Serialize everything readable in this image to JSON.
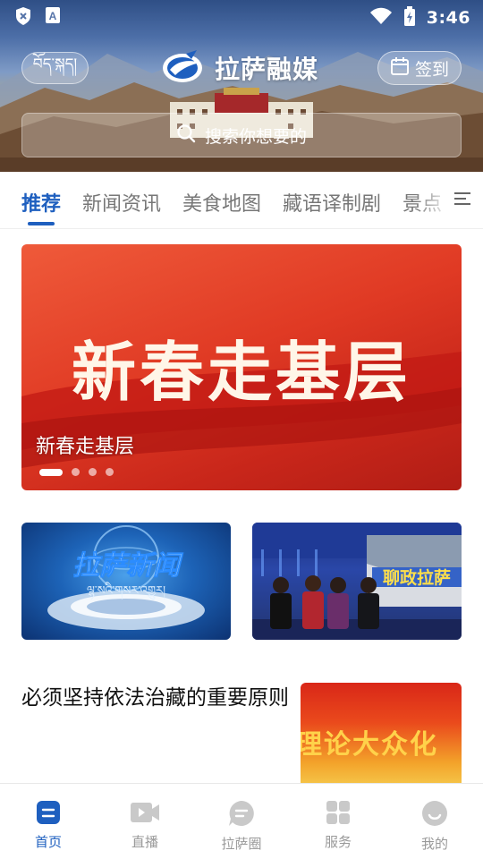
{
  "status_bar": {
    "time": "3:46",
    "icons": [
      "shield-x-icon",
      "font-a-icon",
      "wifi-icon",
      "battery-charging-icon"
    ]
  },
  "header": {
    "tibetan_label": "བོད་སྐད།",
    "app_name": "拉萨融媒",
    "signin_label": "签到",
    "search_placeholder": "搜索你想要的"
  },
  "tabs": {
    "items": [
      {
        "label": "推荐",
        "active": true
      },
      {
        "label": "新闻资讯",
        "active": false
      },
      {
        "label": "美食地图",
        "active": false
      },
      {
        "label": "藏语译制剧",
        "active": false
      },
      {
        "label": "景点",
        "active": false
      }
    ]
  },
  "banner": {
    "art_text": "新春走基层",
    "caption": "新春走基层",
    "slide_count": 4,
    "active_slide": 1
  },
  "cards": [
    {
      "art_text": "拉萨新闻",
      "art_subtext": "ལྷ་སའི་གསར་འགྱུར།"
    },
    {
      "art_text": "聊政拉萨",
      "art_subtext": "聊政拉萨"
    }
  ],
  "article": {
    "title": "必须坚持依法治藏的重要原则",
    "thumb_text": "理论大众化"
  },
  "bottom_nav": {
    "items": [
      {
        "label": "首页",
        "icon": "home-icon",
        "active": true
      },
      {
        "label": "直播",
        "icon": "video-camera-icon",
        "active": false
      },
      {
        "label": "拉萨圈",
        "icon": "chat-bubble-icon",
        "active": false
      },
      {
        "label": "服务",
        "icon": "grid-icon",
        "active": false
      },
      {
        "label": "我的",
        "icon": "profile-icon",
        "active": false
      }
    ]
  },
  "colors": {
    "accent": "#1e5fbf",
    "inactive": "#999999",
    "banner_red": "#e03a24"
  }
}
